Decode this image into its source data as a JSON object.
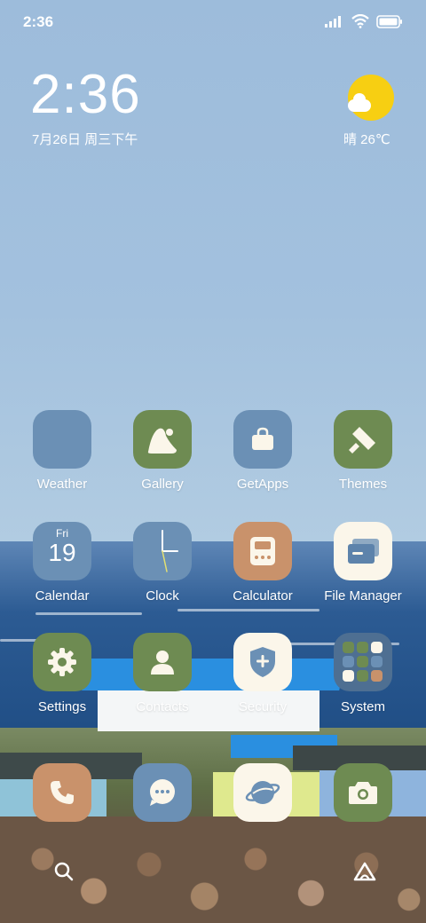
{
  "status_bar": {
    "time": "2:36"
  },
  "clock_widget": {
    "time": "2:36",
    "date": "7月26日 周三下午",
    "weather": "晴 26℃"
  },
  "apps": {
    "weather": "Weather",
    "gallery": "Gallery",
    "getapps": "GetApps",
    "themes": "Themes",
    "calendar": "Calendar",
    "calendar_day": "Fri",
    "calendar_date": "19",
    "clock": "Clock",
    "calculator": "Calculator",
    "file_manager": "File Manager",
    "settings": "Settings",
    "contacts": "Contacts",
    "security": "Security",
    "system": "System"
  },
  "colors": {
    "icon_blue": "#6b90b5",
    "icon_green": "#6e8b52",
    "icon_tan": "#c9926b",
    "icon_cream": "#fbf6ea",
    "sun": "#f7cf12"
  }
}
